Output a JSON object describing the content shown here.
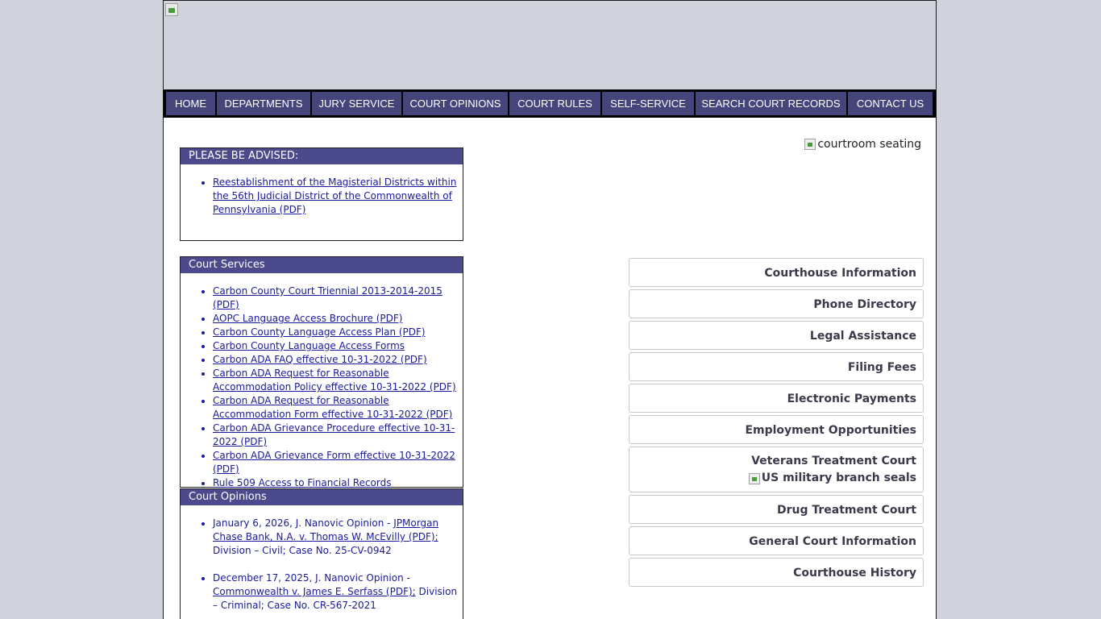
{
  "banner": {
    "image_alt": ""
  },
  "nav": [
    {
      "label": "HOME"
    },
    {
      "label": "DEPARTMENTS"
    },
    {
      "label": "JURY SERVICE"
    },
    {
      "label": "COURT OPINIONS"
    },
    {
      "label": "COURT RULES"
    },
    {
      "label": "SELF-SERVICE"
    },
    {
      "label": "SEARCH COURT RECORDS"
    },
    {
      "label": "CONTACT US"
    }
  ],
  "advised": {
    "title": "PLEASE BE ADVISED:",
    "items": [
      "Reestablishment of the Magisterial Districts within the 56th Judicial District of the Commonwealth of Pennsylvania (PDF)"
    ]
  },
  "services": {
    "title": "Court Services",
    "items": [
      "Carbon County Court Triennial 2013-2014-2015 (PDF)",
      "AOPC Language Access Brochure (PDF)",
      "Carbon County Language Access Plan (PDF)",
      "Carbon County Language Access Forms",
      "Carbon ADA FAQ effective 10-31-2022 (PDF)",
      "Carbon ADA Request for Reasonable Accommodation Policy effective 10-31-2022 (PDF)",
      "Carbon ADA Request for Reasonable Accommodation Form effective 10-31-2022 (PDF)",
      "Carbon ADA Grievance Procedure effective 10-31-2022 (PDF)",
      "Carbon ADA Grievance Form effective 10-31-2022 (PDF)",
      "Rule 509 Access to Financial Records"
    ]
  },
  "opinions": {
    "title": "Court Opinions",
    "items": [
      {
        "prefix": "January 6, 2026, J. Nanovic Opinion - ",
        "link": "JPMorgan Chase Bank, N.A. v. Thomas W. McEvilly (PDF);",
        "suffix": " Division – Civil; Case No. 25-CV-0942"
      },
      {
        "prefix": "December 17, 2025, J. Nanovic Opinion - ",
        "link": "Commonwealth v. James E. Serfass (PDF);",
        "suffix": " Division – Criminal; Case No. CR-567-2021"
      }
    ]
  },
  "courtroom_image_alt": "courtroom seating",
  "quicklinks": [
    {
      "label": "Courthouse Information"
    },
    {
      "label": "Phone Directory"
    },
    {
      "label": "Legal Assistance"
    },
    {
      "label": "Filing Fees"
    },
    {
      "label": "Electronic Payments"
    },
    {
      "label": "Employment Opportunities"
    },
    {
      "label": "Veterans Treatment Court",
      "image_alt": "US military branch seals"
    },
    {
      "label": "Drug Treatment Court"
    },
    {
      "label": "General Court Information"
    },
    {
      "label": "Courthouse History"
    }
  ]
}
